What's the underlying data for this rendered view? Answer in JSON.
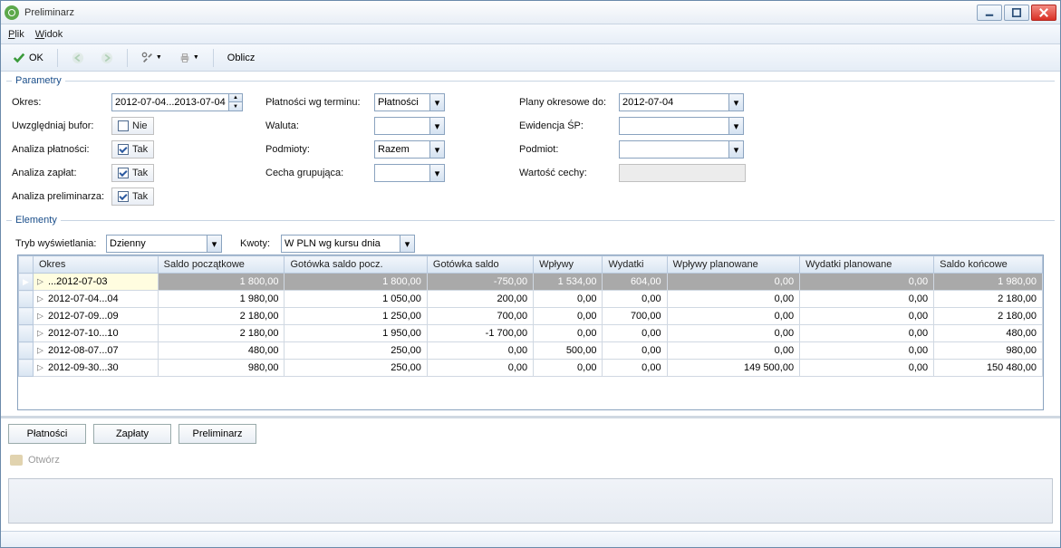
{
  "window": {
    "title": "Preliminarz"
  },
  "menu": {
    "plik": "Plik",
    "widok": "Widok"
  },
  "toolbar": {
    "ok": "OK",
    "oblicz": "Oblicz"
  },
  "params": {
    "legend": "Parametry",
    "okres_label": "Okres:",
    "okres_value": "2012-07-04...2013-07-04",
    "uwzg_bufor_label": "Uwzględniaj bufor:",
    "uwzg_bufor_text": "Nie",
    "analiza_platnosci_label": "Analiza płatności:",
    "tak": "Tak",
    "analiza_zaplat_label": "Analiza zapłat:",
    "analiza_prelim_label": "Analiza preliminarza:",
    "platnosci_wg_terminu_label": "Płatności wg terminu:",
    "platnosci_wg_terminu_value": "Płatności",
    "waluta_label": "Waluta:",
    "waluta_value": "",
    "podmioty_label": "Podmioty:",
    "podmioty_value": "Razem",
    "cecha_grup_label": "Cecha grupująca:",
    "cecha_grup_value": "",
    "plany_okresowe_label": "Plany okresowe do:",
    "plany_okresowe_value": "2012-07-04",
    "ewidencja_sp_label": "Ewidencja ŚP:",
    "ewidencja_sp_value": "",
    "podmiot_label": "Podmiot:",
    "podmiot_value": "",
    "wartosc_cechy_label": "Wartość cechy:"
  },
  "elementy": {
    "legend": "Elementy",
    "tryb_label": "Tryb wyświetlania:",
    "tryb_value": "Dzienny",
    "kwoty_label": "Kwoty:",
    "kwoty_value": "W PLN wg kursu dnia",
    "columns": [
      "Okres",
      "Saldo początkowe",
      "Gotówka saldo pocz.",
      "Gotówka saldo",
      "Wpływy",
      "Wydatki",
      "Wpływy planowane",
      "Wydatki planowane",
      "Saldo końcowe"
    ],
    "rows": [
      {
        "okres": "...2012-07-03",
        "sp": "1 800,00",
        "gsp": "1 800,00",
        "gs": "-750,00",
        "wpl": "1 534,00",
        "wyd": "604,00",
        "wplp": "0,00",
        "wydp": "0,00",
        "sk": "1 980,00",
        "selected": true
      },
      {
        "okres": "2012-07-04...04",
        "sp": "1 980,00",
        "gsp": "1 050,00",
        "gs": "200,00",
        "wpl": "0,00",
        "wyd": "0,00",
        "wplp": "0,00",
        "wydp": "0,00",
        "sk": "2 180,00"
      },
      {
        "okres": "2012-07-09...09",
        "sp": "2 180,00",
        "gsp": "1 250,00",
        "gs": "700,00",
        "wpl": "0,00",
        "wyd": "700,00",
        "wplp": "0,00",
        "wydp": "0,00",
        "sk": "2 180,00"
      },
      {
        "okres": "2012-07-10...10",
        "sp": "2 180,00",
        "gsp": "1 950,00",
        "gs": "-1 700,00",
        "wpl": "0,00",
        "wyd": "0,00",
        "wplp": "0,00",
        "wydp": "0,00",
        "sk": "480,00"
      },
      {
        "okres": "2012-08-07...07",
        "sp": "480,00",
        "gsp": "250,00",
        "gs": "0,00",
        "wpl": "500,00",
        "wyd": "0,00",
        "wplp": "0,00",
        "wydp": "0,00",
        "sk": "980,00"
      },
      {
        "okres": "2012-09-30...30",
        "sp": "980,00",
        "gsp": "250,00",
        "gs": "0,00",
        "wpl": "0,00",
        "wyd": "0,00",
        "wplp": "149 500,00",
        "wydp": "0,00",
        "sk": "150 480,00"
      }
    ]
  },
  "footer": {
    "platnosci": "Płatności",
    "zaplaty": "Zapłaty",
    "preliminarz": "Preliminarz",
    "otworz": "Otwórz"
  }
}
